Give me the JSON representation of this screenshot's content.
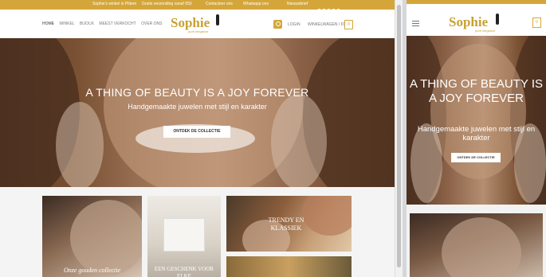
{
  "topbar": {
    "items": [
      "Sophie's winkel in Pittem",
      "Gratis verzending vanaf €50",
      "Contacteer ons",
      "Whatsapp ons",
      "Nieuwsbrief"
    ]
  },
  "nav": {
    "items": [
      "HOME",
      "WINKEL",
      "BIJOUX",
      "MEEST VERKOCHT",
      "OVER ONS"
    ]
  },
  "brand": {
    "name": "Sophie",
    "tagline": "pure elegance"
  },
  "header": {
    "login": "LOGIN",
    "cart_label": "WINKELWAGEN / €0",
    "cart_count": "0"
  },
  "hero": {
    "title": "A THING OF BEAUTY IS A JOY FOREVER",
    "subtitle": "Handgemaakte juwelen met stijl en karakter",
    "button": "ONTDEK DE COLLECTIE"
  },
  "tiles": [
    {
      "label": "Onze gouden collectie"
    },
    {
      "label": "EEN GESCHENK VOOR ELKE"
    },
    {
      "label": "TRENDY EN KLASSIEK"
    }
  ],
  "mobile": {
    "title": "A THING OF BEAUTY IS A JOY FOREVER",
    "subtitle": "Handgemaakte juwelen met stijl en karakter",
    "button": "ONTDEK DE COLLECTIE",
    "cart_count": "0"
  },
  "colors": {
    "accent": "#d4a63a",
    "brand_text": "#c9a032"
  }
}
